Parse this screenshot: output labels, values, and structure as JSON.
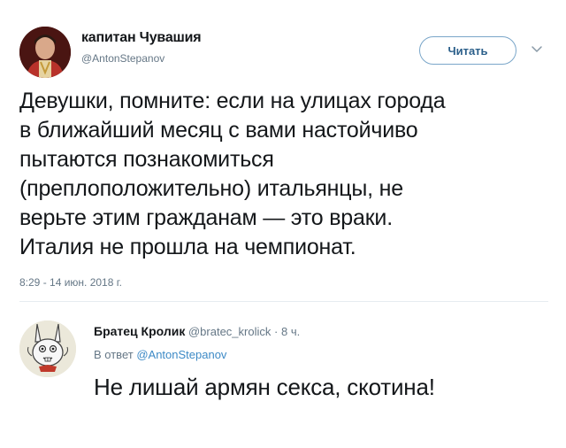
{
  "tweet": {
    "author_name": "капитан Чувашия",
    "author_handle": "@AntonStepanov",
    "follow_label": "Читать",
    "text_lines": [
      "Девушки, помните: если на улицах города",
      "в ближайший месяц с вами настойчиво",
      "пытаются познакомиться",
      "(преплоположительно) итальянцы, не",
      "верьте этим гражданам — это враки.",
      "Италия не прошла на чемпионат."
    ],
    "timestamp": "8:29 - 14 июн. 2018 г."
  },
  "reply": {
    "author_name": "Братец Кролик",
    "author_handle": "@bratec_krolick",
    "separator": "·",
    "time_ago": "8 ч.",
    "in_reply_prefix": "В ответ",
    "in_reply_handle": "@AntonStepanov",
    "text": "Не лишай армян секса, скотина!"
  },
  "colors": {
    "text_primary": "#14171a",
    "text_secondary": "#657786",
    "link": "#3d8ac6",
    "follow_border": "#7aa6c9",
    "follow_text": "#2b5f8a",
    "divider": "#e6ecf0"
  },
  "icons": {
    "more_menu": "chevron-down-icon"
  }
}
